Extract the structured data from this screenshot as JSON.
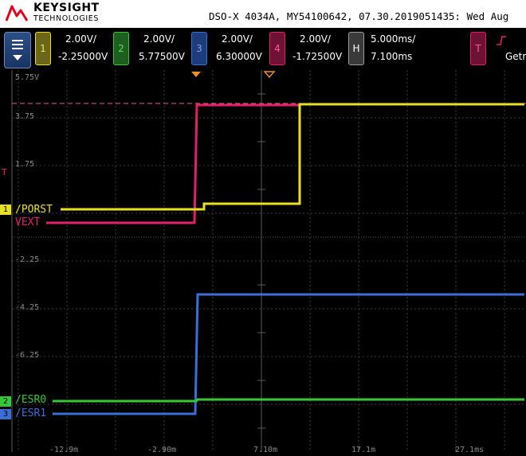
{
  "header": {
    "brand": "KEYSIGHT",
    "brand_sub": "TECHNOLOGIES",
    "scope_info": "DSO-X 4034A, MY54100642, 07.30.2019051435: Wed Aug"
  },
  "channels": [
    {
      "num": "1",
      "scale": "2.00V/",
      "offset": "-2.25000V",
      "color": "#e8e022"
    },
    {
      "num": "2",
      "scale": "2.00V/",
      "offset": "5.77500V",
      "color": "#37c837"
    },
    {
      "num": "3",
      "scale": "2.00V/",
      "offset": "6.30000V",
      "color": "#3a6fd8"
    },
    {
      "num": "4",
      "scale": "2.00V/",
      "offset": "-1.72500V",
      "color": "#e0206e"
    }
  ],
  "horizontal": {
    "label": "H",
    "scale": "5.000ms/",
    "delay": "7.100ms"
  },
  "trigger": {
    "label": "T",
    "source": "Getr"
  },
  "y_axis": [
    "5.75V",
    "3.75",
    "1.75",
    "-2.25",
    "-4.25",
    "-6.25"
  ],
  "x_axis": [
    "-12.9m",
    "-2.90m",
    "7.10m",
    "17.1m",
    "27.1ms"
  ],
  "traces": {
    "ch1_label": "/PORST",
    "ch4_label": "VEXT",
    "ch2_label": "/ESR0",
    "ch3_label": "/ESR1"
  },
  "markers": {
    "ch1": "1",
    "ch2": "2",
    "ch3": "3",
    "trig": "T"
  }
}
